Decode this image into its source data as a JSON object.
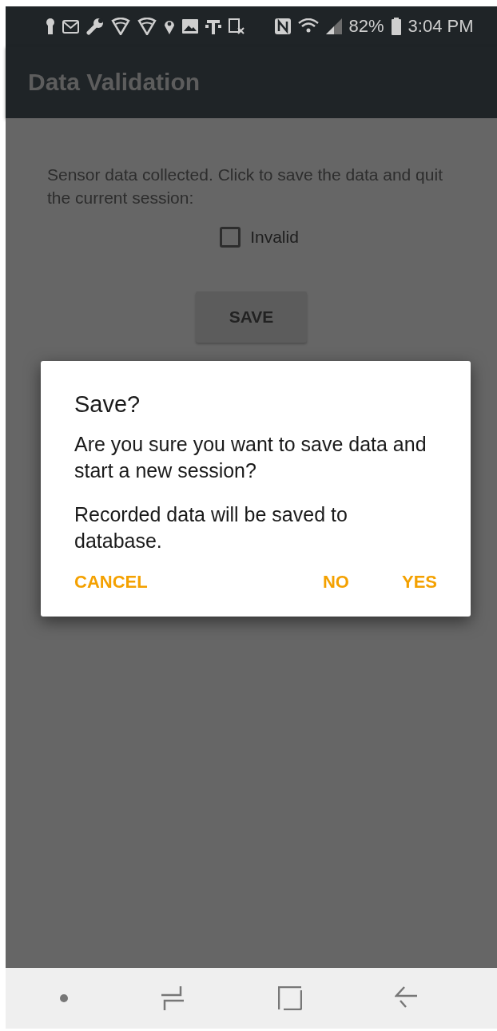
{
  "status_bar": {
    "battery": "82%",
    "time": "3:04 PM"
  },
  "app_bar": {
    "title": "Data Validation"
  },
  "content": {
    "message": "Sensor data collected. Click to save the data and quit the current session:",
    "checkbox": {
      "label": "Invalid",
      "checked": false
    },
    "button": "SAVE"
  },
  "dialog": {
    "title": "Save?",
    "message": "Are you sure you want to save data and start a new session?",
    "note": "Recorded data will be saved to database.",
    "buttons": [
      "CANCEL",
      "NO",
      "YES"
    ]
  }
}
